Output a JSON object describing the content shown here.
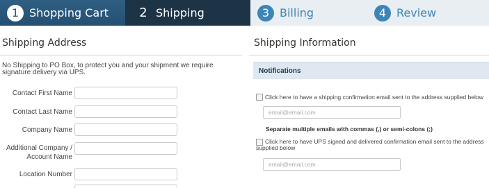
{
  "steps": [
    {
      "number": "1",
      "label": "Shopping Cart"
    },
    {
      "number": "2",
      "label": "Shipping"
    },
    {
      "number": "3",
      "label": "Billing"
    },
    {
      "number": "4",
      "label": "Review"
    }
  ],
  "shipping_address": {
    "title": "Shipping Address",
    "notice": "No Shipping to PO Box, to protect you and your shipment we require signature delivery via UPS.",
    "fields": [
      {
        "label": "Contact First Name",
        "value": ""
      },
      {
        "label": "Contact Last Name",
        "value": ""
      },
      {
        "label": "Company Name",
        "value": ""
      },
      {
        "label": "Additional Company / Account Name",
        "value": ""
      },
      {
        "label": "Location Number",
        "value": ""
      }
    ]
  },
  "shipping_info": {
    "title": "Shipping Information",
    "notifications_header": "Notifications",
    "checkbox_1_text": "Click here to have a shipping confirmation email sent to the address supplied below",
    "email_1_placeholder": "email@email.com",
    "separator_note": "Separate multiple emails with commas (,) or semi-colons (;)",
    "checkbox_2_text": "Click here to have UPS signed and delivered confirmation email sent to the address supplied below",
    "email_2_placeholder": "email@email.com"
  }
}
